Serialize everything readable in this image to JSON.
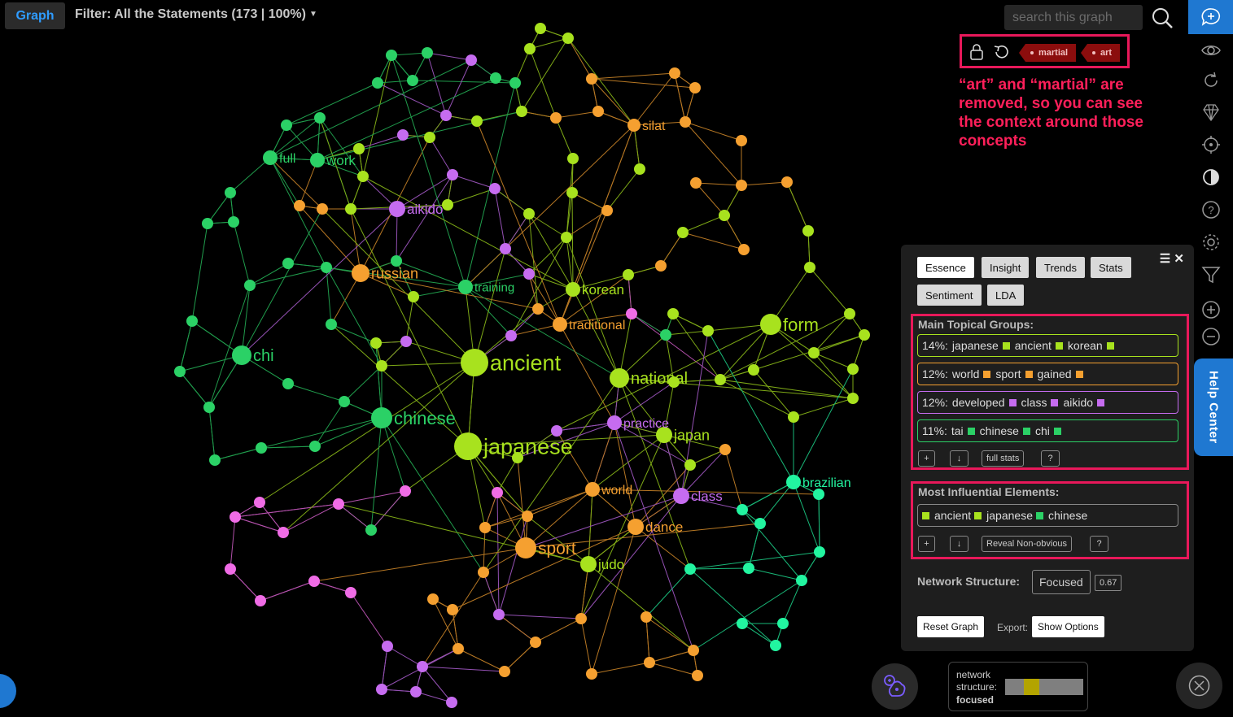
{
  "topbar": {
    "graph_tab": "Graph",
    "filter_text": "Filter: All the Statements (173 | 100%)",
    "search_placeholder": "search this graph"
  },
  "removed_filter": {
    "tags": [
      "martial",
      "art"
    ],
    "annotation": "“art” and “martial” are removed, so you can see the context around those concepts"
  },
  "colors": {
    "accent_blue": "#1f78d1",
    "highlight": "#e8185a",
    "lime": "#a8e21e",
    "green": "#2bd166",
    "orange": "#f5a030",
    "purple": "#c66cf0",
    "pink": "#f06ce6",
    "teal": "#22f5a0"
  },
  "graph_labels": [
    {
      "text": "silat",
      "color": "orange"
    },
    {
      "text": "full",
      "color": "green"
    },
    {
      "text": "work",
      "color": "green"
    },
    {
      "text": "aikido",
      "color": "purple"
    },
    {
      "text": "russian",
      "color": "orange"
    },
    {
      "text": "training",
      "color": "green"
    },
    {
      "text": "korean",
      "color": "lime"
    },
    {
      "text": "traditional",
      "color": "orange"
    },
    {
      "text": "form",
      "color": "lime"
    },
    {
      "text": "chi",
      "color": "green"
    },
    {
      "text": "ancient",
      "color": "lime"
    },
    {
      "text": "national",
      "color": "lime"
    },
    {
      "text": "chinese",
      "color": "green"
    },
    {
      "text": "practice",
      "color": "purple"
    },
    {
      "text": "japan",
      "color": "lime"
    },
    {
      "text": "japanese",
      "color": "lime"
    },
    {
      "text": "brazilian",
      "color": "teal"
    },
    {
      "text": "world",
      "color": "orange"
    },
    {
      "text": "class",
      "color": "purple"
    },
    {
      "text": "dance",
      "color": "orange"
    },
    {
      "text": "sport",
      "color": "orange"
    },
    {
      "text": "judo",
      "color": "lime"
    }
  ],
  "panel": {
    "tabs": [
      "Essence",
      "Insight",
      "Trends",
      "Stats",
      "Sentiment",
      "LDA"
    ],
    "topical_title": "Main Topical Groups:",
    "topics": [
      {
        "pct": "14%:",
        "words": [
          "japanese",
          "ancient",
          "korean"
        ],
        "color": "#a8e21e"
      },
      {
        "pct": "12%:",
        "words": [
          "world",
          "sport",
          "gained"
        ],
        "color": "#f5a030"
      },
      {
        "pct": "12%:",
        "words": [
          "developed",
          "class",
          "aikido"
        ],
        "color": "#c66cf0"
      },
      {
        "pct": "11%:",
        "words": [
          "tai",
          "chinese",
          "chi"
        ],
        "color": "#2bd166"
      }
    ],
    "topic_buttons": [
      "+",
      "↓",
      "full stats",
      "?"
    ],
    "influential_title": "Most Influential Elements:",
    "influential": [
      {
        "word": "ancient",
        "color": "#a8e21e"
      },
      {
        "word": "japanese",
        "color": "#a8e21e"
      },
      {
        "word": "chinese",
        "color": "#2bd166"
      }
    ],
    "influential_buttons": [
      "+",
      "↓",
      "Reveal Non-obvious",
      "?"
    ],
    "network_structure_label": "Network Structure:",
    "network_structure_value": "Focused",
    "network_structure_score": "0.67",
    "reset_button": "Reset Graph",
    "export_label": "Export:",
    "show_options_button": "Show Options"
  },
  "network_box": {
    "line1": "network",
    "line2": "structure:",
    "value": "focused",
    "level": 0.3
  },
  "help_center": "Help Center"
}
